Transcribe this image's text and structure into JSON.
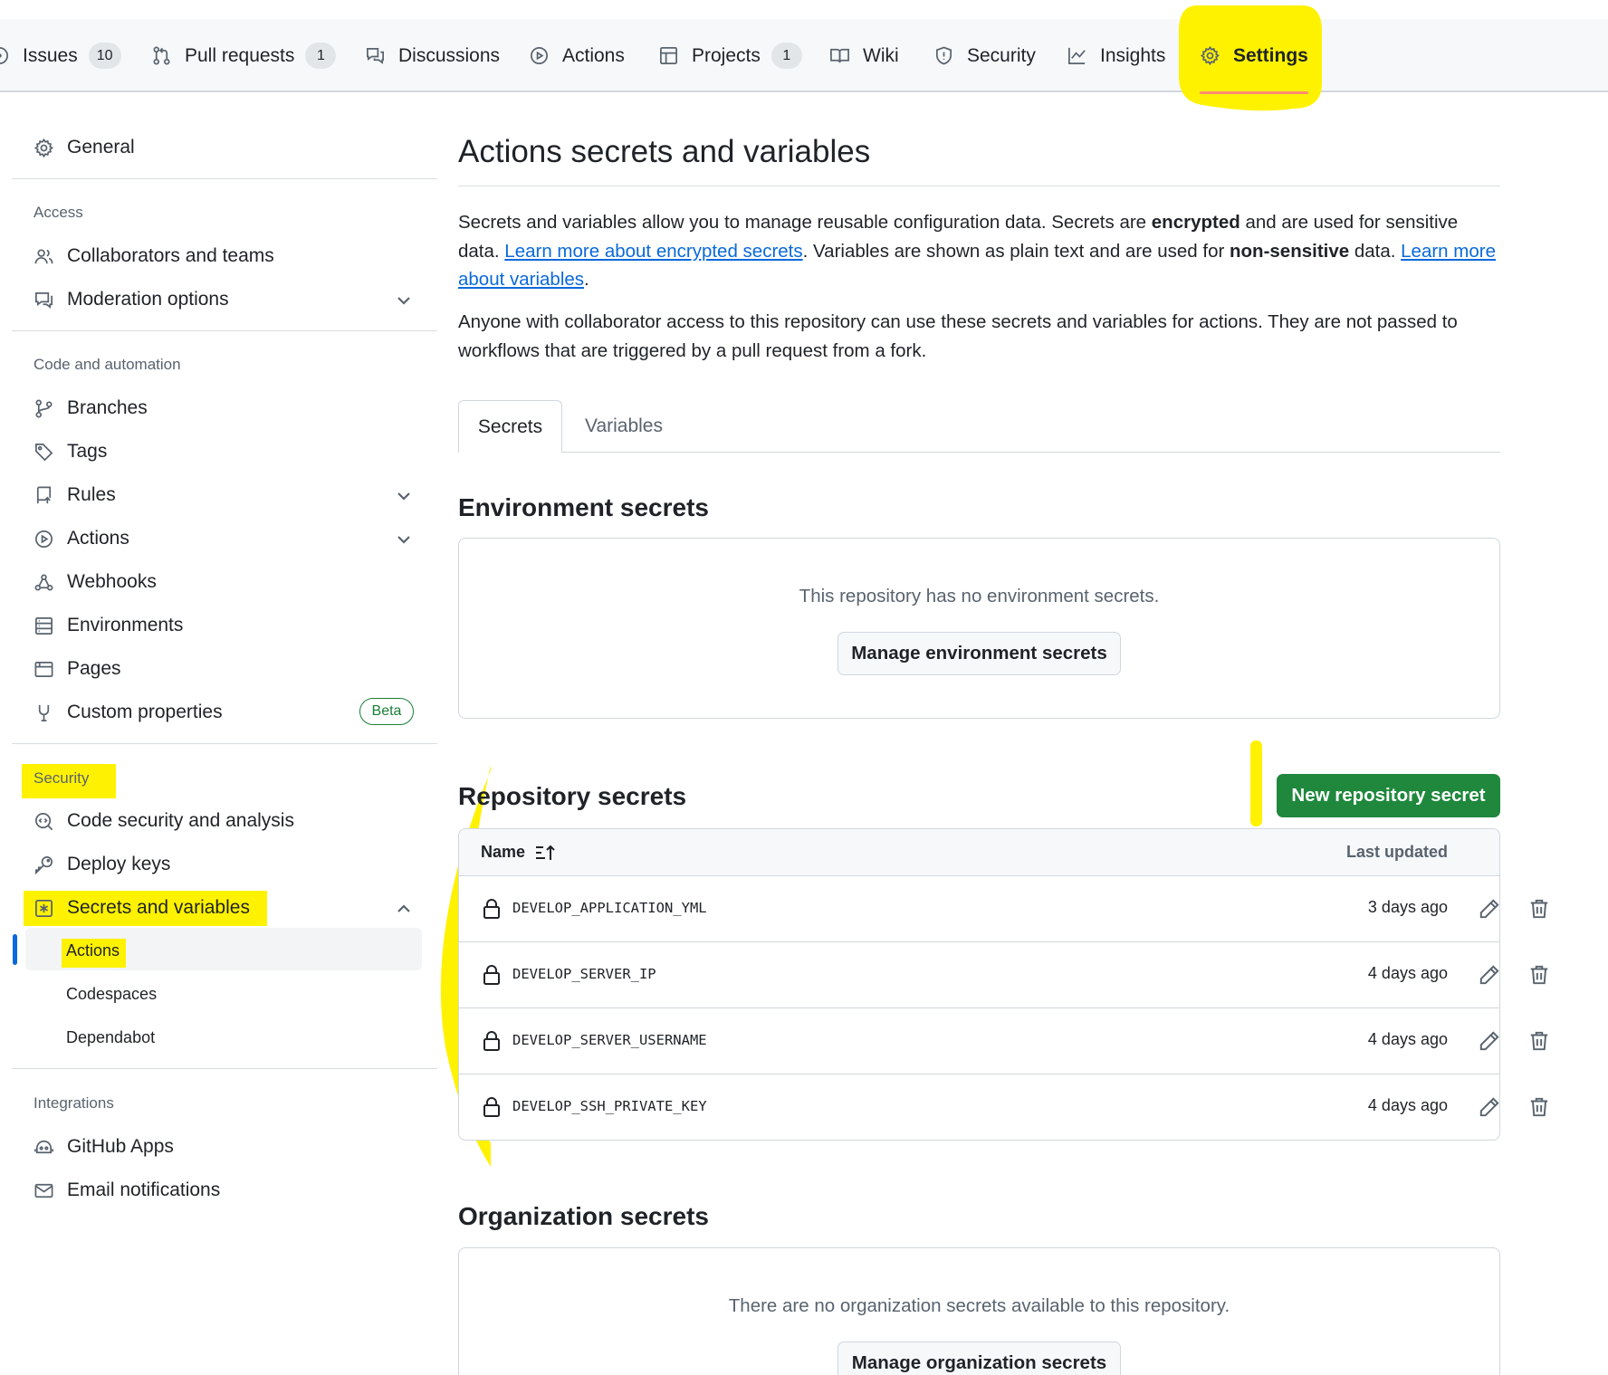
{
  "nav": {
    "issues": {
      "label": "Issues",
      "count": "10"
    },
    "pulls": {
      "label": "Pull requests",
      "count": "1"
    },
    "discussions": {
      "label": "Discussions"
    },
    "actions": {
      "label": "Actions"
    },
    "projects": {
      "label": "Projects",
      "count": "1"
    },
    "wiki": {
      "label": "Wiki"
    },
    "security": {
      "label": "Security"
    },
    "insights": {
      "label": "Insights"
    },
    "settings": {
      "label": "Settings"
    }
  },
  "sidebar": {
    "general": "General",
    "access_heading": "Access",
    "collaborators": "Collaborators and teams",
    "moderation": "Moderation options",
    "code_heading": "Code and automation",
    "branches": "Branches",
    "tags": "Tags",
    "rules": "Rules",
    "actions": "Actions",
    "webhooks": "Webhooks",
    "environments": "Environments",
    "pages": "Pages",
    "custom_properties": "Custom properties",
    "beta_badge": "Beta",
    "security_heading": "Security",
    "code_security": "Code security and analysis",
    "deploy_keys": "Deploy keys",
    "secrets_vars": "Secrets and variables",
    "sub_actions": "Actions",
    "sub_codespaces": "Codespaces",
    "sub_dependabot": "Dependabot",
    "integrations_heading": "Integrations",
    "github_apps": "GitHub Apps",
    "email_notifications": "Email notifications"
  },
  "main": {
    "title": "Actions secrets and variables",
    "intro": {
      "p1_a": "Secrets and variables allow you to manage reusable configuration data. Secrets are ",
      "p1_b": "encrypted",
      "p1_c": " and are used for sensitive data. ",
      "p1_link1": "Learn more about encrypted secrets",
      "p1_d": ". Variables are shown as plain text and are used for ",
      "p1_e": "non-sensitive",
      "p1_f": " data. ",
      "p1_link2": "Learn more about variables",
      "p1_g": ".",
      "p2": "Anyone with collaborator access to this repository can use these secrets and variables for actions. They are not passed to workflows that are triggered by a pull request from a fork."
    },
    "tabs": {
      "secrets": "Secrets",
      "variables": "Variables"
    },
    "env": {
      "heading": "Environment secrets",
      "empty": "This repository has no environment secrets.",
      "button": "Manage environment secrets"
    },
    "repo": {
      "heading": "Repository secrets",
      "new_button": "New repository secret",
      "col_name": "Name",
      "col_updated": "Last updated",
      "rows": [
        {
          "name": "DEVELOP_APPLICATION_YML",
          "updated": "3 days ago"
        },
        {
          "name": "DEVELOP_SERVER_IP",
          "updated": "4 days ago"
        },
        {
          "name": "DEVELOP_SERVER_USERNAME",
          "updated": "4 days ago"
        },
        {
          "name": "DEVELOP_SSH_PRIVATE_KEY",
          "updated": "4 days ago"
        }
      ]
    },
    "org": {
      "heading": "Organization secrets",
      "empty": "There are no organization secrets available to this repository.",
      "button": "Manage organization secrets"
    }
  },
  "colors": {
    "highlight": "#fff200",
    "primary_button": "#1f883d",
    "link": "#0969da",
    "selected_tab_underline": "#fd8c73"
  }
}
